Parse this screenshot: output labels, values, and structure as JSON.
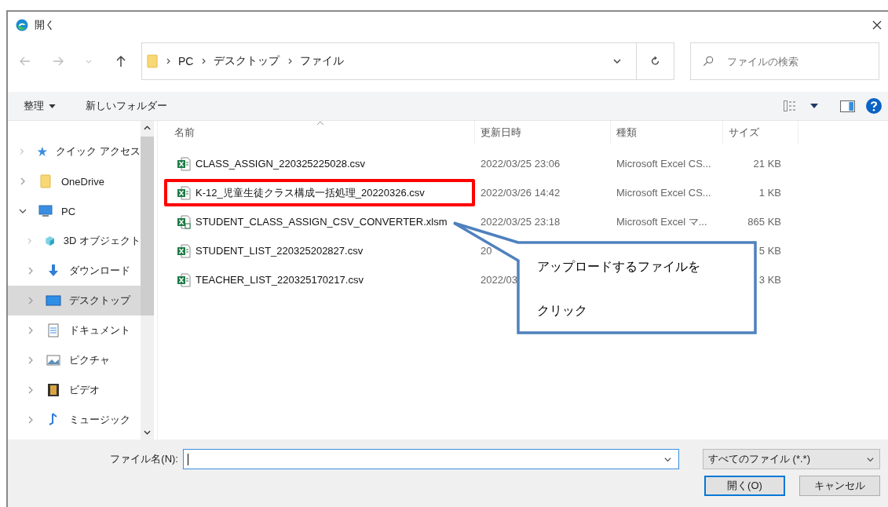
{
  "window": {
    "title": "開く"
  },
  "address": {
    "crumbs": [
      "PC",
      "デスクトップ",
      "ファイル"
    ]
  },
  "search": {
    "placeholder": "ファイルの検索"
  },
  "toolbar": {
    "organize": "整理",
    "new_folder": "新しいフォルダー"
  },
  "sidebar": {
    "items": [
      {
        "label": "クイック アクセス",
        "kind": "star",
        "expanded": false,
        "selected": false
      },
      {
        "label": "OneDrive",
        "kind": "folder",
        "expanded": false,
        "selected": false
      },
      {
        "label": "PC",
        "kind": "pc",
        "expanded": true,
        "selected": false,
        "children": [
          {
            "label": "3D オブジェクト",
            "kind": "cube",
            "expanded": false,
            "selected": false
          },
          {
            "label": "ダウンロード",
            "kind": "download",
            "expanded": false,
            "selected": false
          },
          {
            "label": "デスクトップ",
            "kind": "desktop",
            "expanded": false,
            "selected": true
          },
          {
            "label": "ドキュメント",
            "kind": "document",
            "expanded": false,
            "selected": false
          },
          {
            "label": "ピクチャ",
            "kind": "picture",
            "expanded": false,
            "selected": false
          },
          {
            "label": "ビデオ",
            "kind": "video",
            "expanded": false,
            "selected": false
          },
          {
            "label": "ミュージック",
            "kind": "music",
            "expanded": false,
            "selected": false
          }
        ]
      }
    ]
  },
  "table": {
    "columns": [
      "名前",
      "更新日時",
      "種類",
      "サイズ"
    ],
    "rows": [
      {
        "name": "CLASS_ASSIGN_220325225028.csv",
        "date": "2022/03/25 23:06",
        "type": "Microsoft Excel CS...",
        "size": "21 KB",
        "kind": "csv",
        "highlighted": false
      },
      {
        "name": "K-12_児童生徒クラス構成一括処理_20220326.csv",
        "date": "2022/03/26 14:42",
        "type": "Microsoft Excel CS...",
        "size": "1 KB",
        "kind": "csv",
        "highlighted": true
      },
      {
        "name": "STUDENT_CLASS_ASSIGN_CSV_CONVERTER.xlsm",
        "date": "2022/03/25 23:18",
        "type": "Microsoft Excel マ...",
        "size": "865 KB",
        "kind": "xlsm",
        "highlighted": false
      },
      {
        "name": "STUDENT_LIST_220325202827.csv",
        "date": "20",
        "size": "5 KB",
        "kind": "csv",
        "highlighted": false
      },
      {
        "name": "TEACHER_LIST_220325170217.csv",
        "date": "2022/03",
        "size": "3 KB",
        "kind": "csv",
        "highlighted": false
      }
    ]
  },
  "callout": {
    "lines": [
      "アップロードするファイルを",
      "クリック"
    ]
  },
  "footer": {
    "filename_label": "ファイル名(N):",
    "filetype": "すべてのファイル (*.*)",
    "buttons": [
      "開く(O)",
      "キャンセル"
    ]
  }
}
